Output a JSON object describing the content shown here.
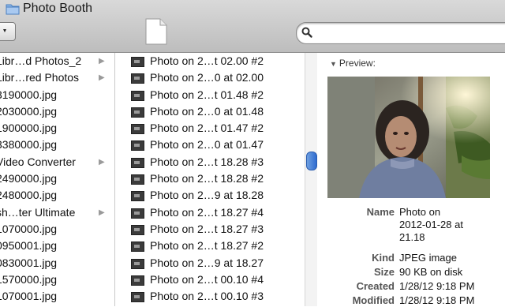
{
  "window": {
    "title": "Photo Booth"
  },
  "search": {
    "placeholder": ""
  },
  "column1": {
    "items": [
      {
        "label": "Libr…d Photos_2",
        "has_children": true
      },
      {
        "label": "Libr…red Photos",
        "has_children": true
      },
      {
        "label": "3190000.jpg",
        "has_children": false
      },
      {
        "label": "2030000.jpg",
        "has_children": false
      },
      {
        "label": "1900000.jpg",
        "has_children": false
      },
      {
        "label": "3380000.jpg",
        "has_children": false
      },
      {
        "label": " Video Converter",
        "has_children": true
      },
      {
        "label": "2490000.jpg",
        "has_children": false
      },
      {
        "label": "2480000.jpg",
        "has_children": false
      },
      {
        "label": "sh…ter Ultimate",
        "has_children": true
      },
      {
        "label": "1070000.jpg",
        "has_children": false
      },
      {
        "label": "0950001.jpg",
        "has_children": false
      },
      {
        "label": "0830001.jpg",
        "has_children": false
      },
      {
        "label": "1570000.jpg",
        "has_children": false
      },
      {
        "label": "1070001.jpg",
        "has_children": false
      }
    ],
    "arrow": "▶"
  },
  "column2": {
    "items": [
      "Photo on 2…t 02.00 #2",
      "Photo on 2…0 at 02.00",
      "Photo on 2…t 01.48 #2",
      "Photo on 2…0 at 01.48",
      "Photo on 2…t 01.47 #2",
      "Photo on 2…0 at 01.47",
      "Photo on 2…t 18.28 #3",
      "Photo on 2…t 18.28 #2",
      "Photo on 2…9 at 18.28",
      "Photo on 2…t 18.27 #4",
      "Photo on 2…t 18.27 #3",
      "Photo on 2…t 18.27 #2",
      "Photo on 2…9 at 18.27",
      "Photo on 2…t 00.10 #4",
      "Photo on 2…t 00.10 #3"
    ]
  },
  "preview": {
    "label": "Preview:",
    "triangle": "▼",
    "info": [
      {
        "key": "Name",
        "value_lines": [
          "Photo on",
          "2012-01-28 at",
          "21.18"
        ]
      },
      {
        "key": "Kind",
        "value_lines": [
          "JPEG image"
        ]
      },
      {
        "key": "Size",
        "value_lines": [
          "90 KB on disk"
        ]
      },
      {
        "key": "Created",
        "value_lines": [
          "1/28/12 9:18 PM"
        ]
      },
      {
        "key": "Modified",
        "value_lines": [
          "1/28/12 9:18 PM"
        ]
      }
    ]
  },
  "colors": {
    "toolbar_top": "#d9d9d9",
    "toolbar_bottom": "#bdbdbd",
    "scroll_thumb": "#2e6bd0",
    "folder": "#8ab4e6"
  }
}
